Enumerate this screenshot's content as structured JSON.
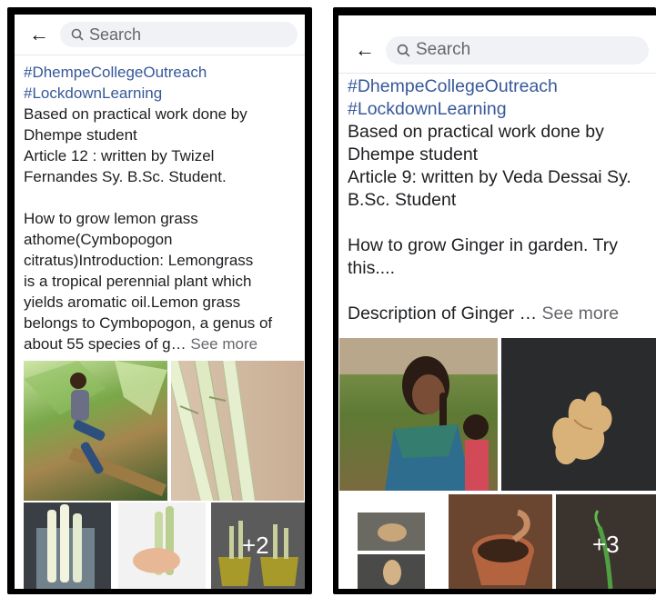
{
  "left_post": {
    "search_placeholder": "Search",
    "hashtags": [
      "#DhempeCollegeOutreach",
      "#LockdownLearning"
    ],
    "lines": [
      "Based on practical work done by",
      "Dhempe student",
      "Article  12 : written by Twizel",
      "Fernandes Sy. B.Sc. Student."
    ],
    "body_lines": [
      "How to grow lemon grass",
      "athome(Cymbopogon",
      "citratus)Introduction: Lemongrass",
      "is a tropical perennial plant which",
      "yields aromatic oil.Lemon grass",
      "belongs to Cymbopogon, a genus of"
    ],
    "last_line": "about 55 species of g…",
    "see_more": "See more",
    "more_photos": "+2"
  },
  "right_post": {
    "search_placeholder": "Search",
    "hashtags": [
      "#DhempeCollegeOutreach",
      "#LockdownLearning"
    ],
    "lines": [
      "Based on practical work done by",
      "Dhempe student",
      "Article  9: written by Veda Dessai Sy.",
      "B.Sc. Student"
    ],
    "body_lines": [
      "How to grow Ginger in garden. Try",
      "this...."
    ],
    "last_line": "Description of Ginger …",
    "see_more": "See more",
    "more_photos": "+3"
  }
}
